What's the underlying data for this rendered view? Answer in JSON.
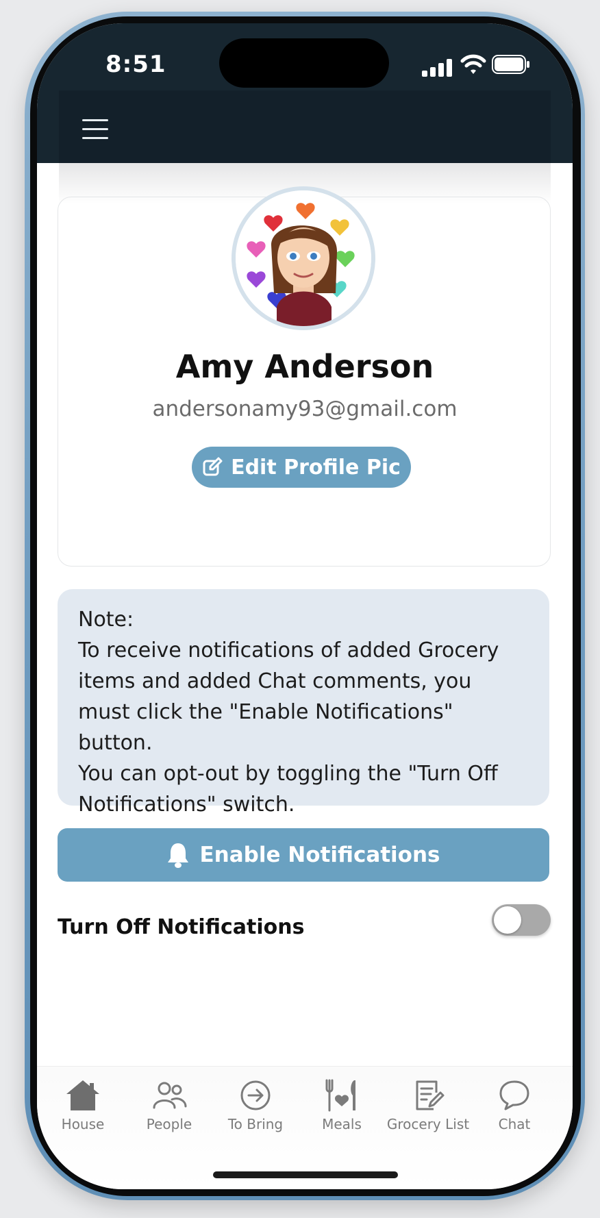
{
  "status_bar": {
    "time": "8:51"
  },
  "profile": {
    "name": "Amy Anderson",
    "email": "andersonamy93@gmail.com",
    "edit_button_label": "Edit Profile Pic"
  },
  "note": {
    "heading": "Note:",
    "lines": [
      "To receive notifications of added Grocery items and added Chat comments, you must click the \"Enable Notifications\" button.",
      "You can opt-out by toggling the \"Turn Off Notifications\" switch."
    ]
  },
  "notifications": {
    "enable_button_label": "Enable Notifications",
    "turn_off_label": "Turn Off Notifications",
    "turn_off_enabled": false
  },
  "tabs": [
    {
      "label": "House",
      "icon": "house-icon"
    },
    {
      "label": "People",
      "icon": "people-icon"
    },
    {
      "label": "To Bring",
      "icon": "arrow-right-circle-icon"
    },
    {
      "label": "Meals",
      "icon": "utensils-heart-icon"
    },
    {
      "label": "Grocery List",
      "icon": "list-edit-icon"
    },
    {
      "label": "Chat",
      "icon": "chat-bubble-icon"
    }
  ],
  "colors": {
    "accent": "#6aa1c1",
    "header": "#13202a",
    "note_bg": "#e2e9f1",
    "phone_frame": "#6f9cc0"
  }
}
